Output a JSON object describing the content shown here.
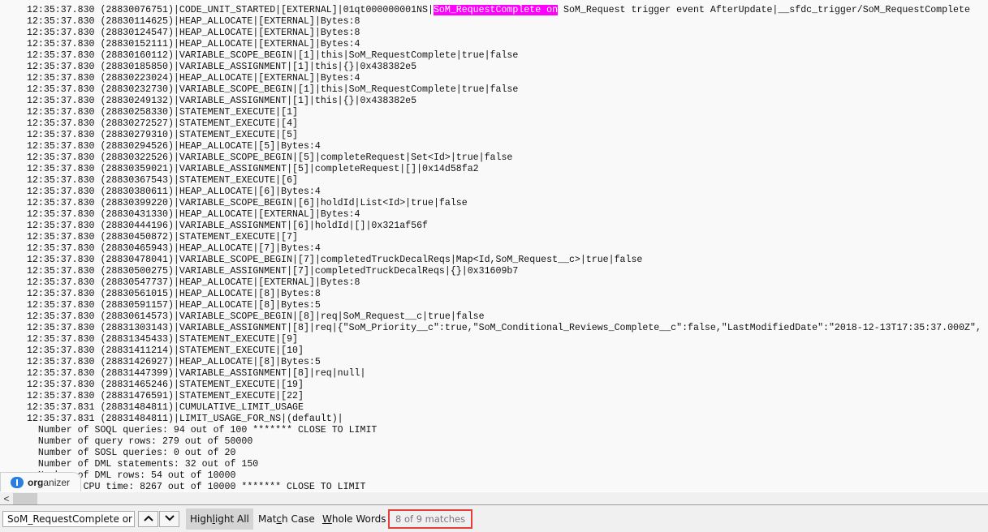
{
  "log": {
    "lines": [
      {
        "ts": "12:35:37.830",
        "id": "(28830076751)",
        "pre": "|CODE_UNIT_STARTED|[EXTERNAL]|01qt000000001NS|",
        "match": "SoM_RequestComplete on",
        "post": " SoM_Request trigger event AfterUpdate|__sfdc_trigger/SoM_RequestComplete"
      },
      {
        "ts": "12:35:37.830",
        "id": "(28830114625)",
        "pre": "|HEAP_ALLOCATE|[EXTERNAL]|Bytes:8"
      },
      {
        "ts": "12:35:37.830",
        "id": "(28830124547)",
        "pre": "|HEAP_ALLOCATE|[EXTERNAL]|Bytes:8"
      },
      {
        "ts": "12:35:37.830",
        "id": "(28830152111)",
        "pre": "|HEAP_ALLOCATE|[EXTERNAL]|Bytes:4"
      },
      {
        "ts": "12:35:37.830",
        "id": "(28830160112)",
        "pre": "|VARIABLE_SCOPE_BEGIN|[1]|this|SoM_RequestComplete|true|false"
      },
      {
        "ts": "12:35:37.830",
        "id": "(28830185850)",
        "pre": "|VARIABLE_ASSIGNMENT|[1]|this|{}|0x438382e5"
      },
      {
        "ts": "12:35:37.830",
        "id": "(28830223024)",
        "pre": "|HEAP_ALLOCATE|[EXTERNAL]|Bytes:4"
      },
      {
        "ts": "12:35:37.830",
        "id": "(28830232730)",
        "pre": "|VARIABLE_SCOPE_BEGIN|[1]|this|SoM_RequestComplete|true|false"
      },
      {
        "ts": "12:35:37.830",
        "id": "(28830249132)",
        "pre": "|VARIABLE_ASSIGNMENT|[1]|this|{}|0x438382e5"
      },
      {
        "ts": "12:35:37.830",
        "id": "(28830258330)",
        "pre": "|STATEMENT_EXECUTE|[1]"
      },
      {
        "ts": "12:35:37.830",
        "id": "(28830272527)",
        "pre": "|STATEMENT_EXECUTE|[4]"
      },
      {
        "ts": "12:35:37.830",
        "id": "(28830279310)",
        "pre": "|STATEMENT_EXECUTE|[5]"
      },
      {
        "ts": "12:35:37.830",
        "id": "(28830294526)",
        "pre": "|HEAP_ALLOCATE|[5]|Bytes:4"
      },
      {
        "ts": "12:35:37.830",
        "id": "(28830322526)",
        "pre": "|VARIABLE_SCOPE_BEGIN|[5]|completeRequest|Set<Id>|true|false"
      },
      {
        "ts": "12:35:37.830",
        "id": "(28830359021)",
        "pre": "|VARIABLE_ASSIGNMENT|[5]|completeRequest|[]|0x14d58fa2"
      },
      {
        "ts": "12:35:37.830",
        "id": "(28830367543)",
        "pre": "|STATEMENT_EXECUTE|[6]"
      },
      {
        "ts": "12:35:37.830",
        "id": "(28830380611)",
        "pre": "|HEAP_ALLOCATE|[6]|Bytes:4"
      },
      {
        "ts": "12:35:37.830",
        "id": "(28830399220)",
        "pre": "|VARIABLE_SCOPE_BEGIN|[6]|holdId|List<Id>|true|false"
      },
      {
        "ts": "12:35:37.830",
        "id": "(28830431330)",
        "pre": "|HEAP_ALLOCATE|[EXTERNAL]|Bytes:4"
      },
      {
        "ts": "12:35:37.830",
        "id": "(28830444196)",
        "pre": "|VARIABLE_ASSIGNMENT|[6]|holdId|[]|0x321af56f"
      },
      {
        "ts": "12:35:37.830",
        "id": "(28830450872)",
        "pre": "|STATEMENT_EXECUTE|[7]"
      },
      {
        "ts": "12:35:37.830",
        "id": "(28830465943)",
        "pre": "|HEAP_ALLOCATE|[7]|Bytes:4"
      },
      {
        "ts": "12:35:37.830",
        "id": "(28830478041)",
        "pre": "|VARIABLE_SCOPE_BEGIN|[7]|completedTruckDecalReqs|Map<Id,SoM_Request__c>|true|false"
      },
      {
        "ts": "12:35:37.830",
        "id": "(28830500275)",
        "pre": "|VARIABLE_ASSIGNMENT|[7]|completedTruckDecalReqs|{}|0x31609b7"
      },
      {
        "ts": "12:35:37.830",
        "id": "(28830547737)",
        "pre": "|HEAP_ALLOCATE|[EXTERNAL]|Bytes:8"
      },
      {
        "ts": "12:35:37.830",
        "id": "(28830561015)",
        "pre": "|HEAP_ALLOCATE|[8]|Bytes:8"
      },
      {
        "ts": "12:35:37.830",
        "id": "(28830591157)",
        "pre": "|HEAP_ALLOCATE|[8]|Bytes:5"
      },
      {
        "ts": "12:35:37.830",
        "id": "(28830614573)",
        "pre": "|VARIABLE_SCOPE_BEGIN|[8]|req|SoM_Request__c|true|false"
      },
      {
        "ts": "12:35:37.830",
        "id": "(28831303143)",
        "pre": "|VARIABLE_ASSIGNMENT|[8]|req|{\"SoM_Priority__c\":true,\"SoM_Conditional_Reviews_Complete__c\":false,\"LastModifiedDate\":\"2018-12-13T17:35:37.000Z\","
      },
      {
        "ts": "12:35:37.830",
        "id": "(28831345433)",
        "pre": "|STATEMENT_EXECUTE|[9]"
      },
      {
        "ts": "12:35:37.830",
        "id": "(28831411214)",
        "pre": "|STATEMENT_EXECUTE|[10]"
      },
      {
        "ts": "12:35:37.830",
        "id": "(28831426927)",
        "pre": "|HEAP_ALLOCATE|[8]|Bytes:5"
      },
      {
        "ts": "12:35:37.830",
        "id": "(28831447399)",
        "pre": "|VARIABLE_ASSIGNMENT|[8]|req|null|"
      },
      {
        "ts": "12:35:37.830",
        "id": "(28831465246)",
        "pre": "|STATEMENT_EXECUTE|[19]"
      },
      {
        "ts": "12:35:37.830",
        "id": "(28831476591)",
        "pre": "|STATEMENT_EXECUTE|[22]"
      },
      {
        "ts": "12:35:37.831",
        "id": "(28831484811)",
        "pre": "|CUMULATIVE_LIMIT_USAGE"
      },
      {
        "ts": "12:35:37.831",
        "id": "(28831484811)",
        "pre": "|LIMIT_USAGE_FOR_NS|(default)|"
      }
    ],
    "limits": [
      "  Number of SOQL queries: 94 out of 100 ******* CLOSE TO LIMIT",
      "  Number of query rows: 279 out of 50000",
      "  Number of SOSL queries: 0 out of 20",
      "  Number of DML statements: 32 out of 150",
      "  Number of DML rows: 54 out of 10000",
      "  Maximum CPU time: 8267 out of 10000 ******* CLOSE TO LIMIT"
    ],
    "highlight_color": "#ff00ff"
  },
  "scrollbar": {
    "left_arrow": "<"
  },
  "organizer": {
    "bold": "org",
    "rest": "anizer"
  },
  "findbar": {
    "query": "SoM_RequestComplete on",
    "prev_icon": "^",
    "next_icon": "v",
    "highlight_all": {
      "pre": "High",
      "u": "l",
      "post": "ight All"
    },
    "match_case": {
      "pre": "Mat",
      "u": "c",
      "post": "h Case"
    },
    "whole_words": {
      "pre": "",
      "u": "W",
      "post": "hole Words"
    },
    "status": "8 of 9 matches",
    "status_border_color": "#e53e3e"
  }
}
